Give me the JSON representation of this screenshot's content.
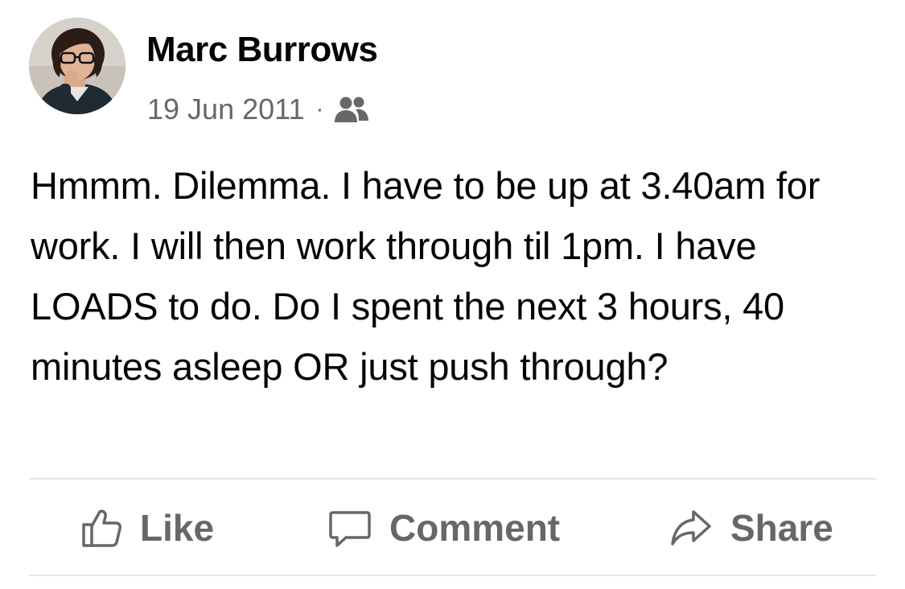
{
  "post": {
    "author": "Marc Burrows",
    "date": "19 Jun 2011",
    "separator": "·",
    "audience_icon": "friends-icon",
    "text": "Hmmm. Dilemma. I have to be up at 3.40am for work. I will then work through til 1pm. I have LOADS to do. Do I spent the next 3 hours, 40 minutes asleep OR just push through?"
  },
  "actions": {
    "like": {
      "label": "Like",
      "icon": "thumbs-up-icon"
    },
    "comment": {
      "label": "Comment",
      "icon": "comment-bubble-icon"
    },
    "share": {
      "label": "Share",
      "icon": "share-arrow-icon"
    }
  },
  "colors": {
    "text_primary": "#050505",
    "text_secondary": "#65676b",
    "divider": "#e4e6eb",
    "background": "#ffffff"
  }
}
